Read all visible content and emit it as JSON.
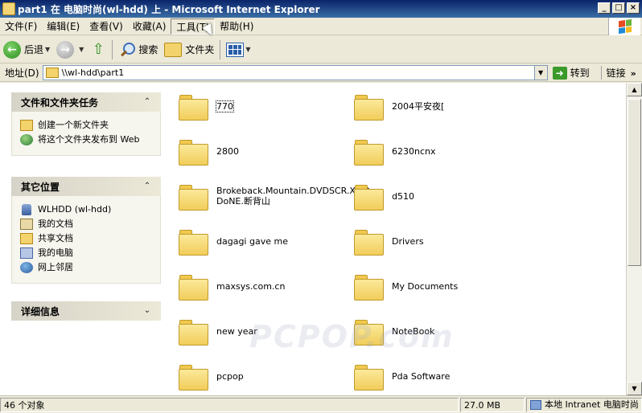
{
  "window": {
    "title": "part1 在 电脑时尚(wl-hdd) 上 - Microsoft Internet Explorer",
    "controls": [
      "_",
      "□",
      "×"
    ]
  },
  "menu": {
    "items": [
      {
        "label": "文件(F)"
      },
      {
        "label": "编辑(E)"
      },
      {
        "label": "查看(V)"
      },
      {
        "label": "收藏(A)"
      },
      {
        "label": "工具(T)",
        "active": true
      },
      {
        "label": "帮助(H)"
      }
    ]
  },
  "toolbar": {
    "back_label": "后退",
    "search_label": "搜索",
    "folders_label": "文件夹"
  },
  "address": {
    "label": "地址(D)",
    "value": "\\\\wl-hdd\\part1",
    "go_label": "转到",
    "links_label": "链接"
  },
  "sidebar": {
    "tasks_panel": {
      "title": "文件和文件夹任务",
      "items": [
        {
          "label": "创建一个新文件夹",
          "icon": "new-folder-icon"
        },
        {
          "label": "将这个文件夹发布到 Web",
          "icon": "publish-web-icon"
        }
      ]
    },
    "places_panel": {
      "title": "其它位置",
      "items": [
        {
          "label": "WLHDD (wl-hdd)",
          "icon": "network-drive-icon"
        },
        {
          "label": "我的文档",
          "icon": "my-documents-icon"
        },
        {
          "label": "共享文档",
          "icon": "shared-documents-icon"
        },
        {
          "label": "我的电脑",
          "icon": "my-computer-icon"
        },
        {
          "label": "网上邻居",
          "icon": "network-places-icon"
        }
      ]
    },
    "details_panel": {
      "title": "详细信息"
    }
  },
  "folders": [
    "770",
    "2004平安夜[",
    "2800",
    "6230ncnx",
    "Brokeback.Mountain.DVDSCR.XviD-DoNE.断背山",
    "d510",
    "dagagi gave me",
    "Drivers",
    "maxsys.com.cn",
    "My Documents",
    "new year",
    "NoteBook",
    "pcpop",
    "Pda Software"
  ],
  "watermark": "PCPOP.com",
  "status": {
    "count": "46 个对象",
    "size": "27.0 MB",
    "zone": "本地 Intranet 电脑时尚"
  }
}
